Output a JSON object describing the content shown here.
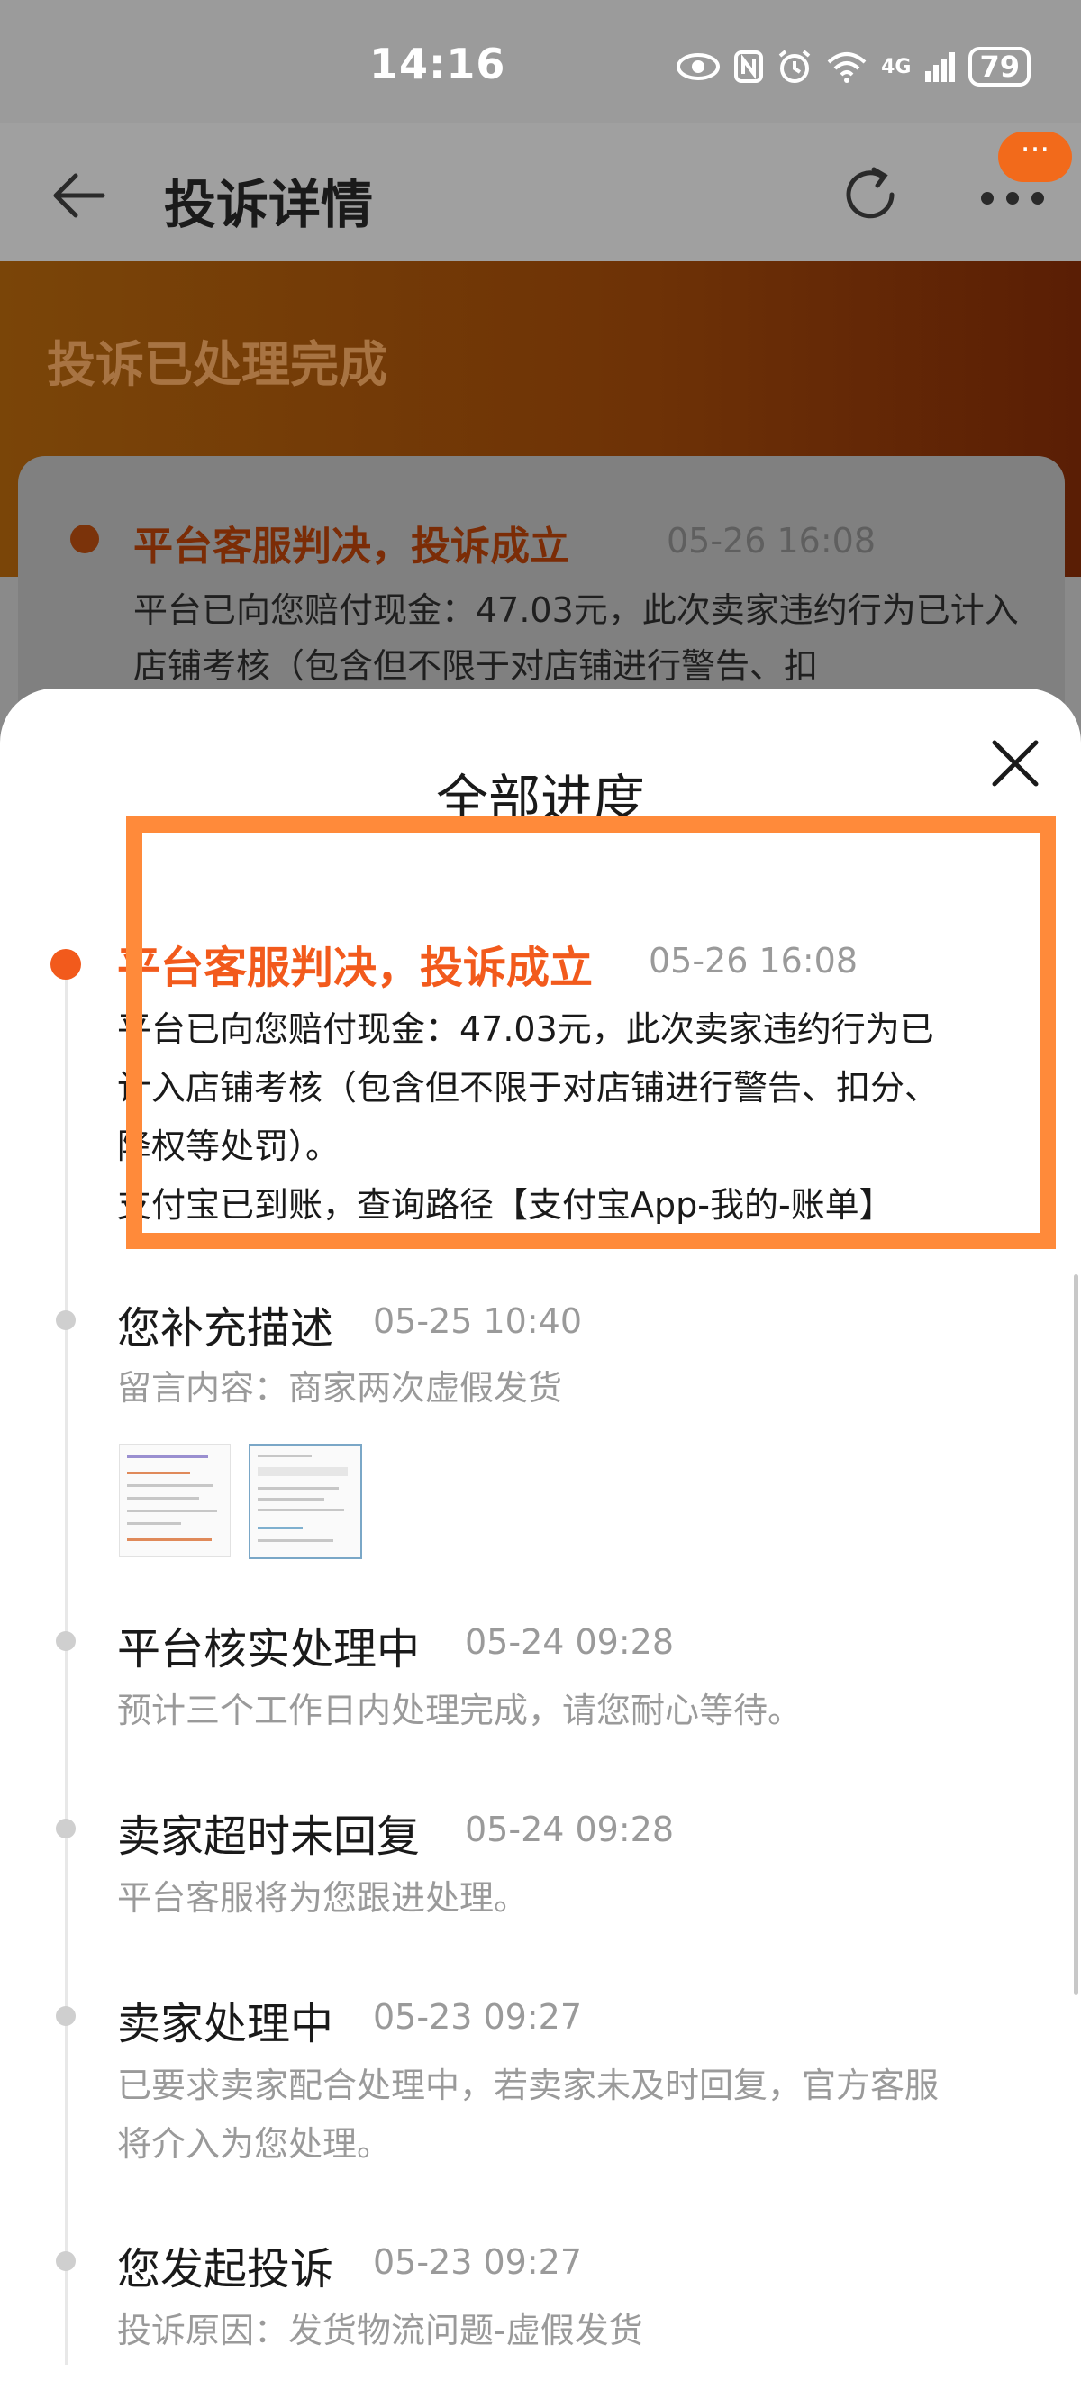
{
  "status_bar": {
    "time": "14:16",
    "indicators": [
      "eye-icon",
      "nfc-icon",
      "alarm-icon",
      "wifi-icon",
      "4G",
      "signal-icon"
    ],
    "net": "4G",
    "battery": "79"
  },
  "header": {
    "title": "投诉详情",
    "badge": "···"
  },
  "banner": {
    "status": "投诉已处理完成",
    "card_title": "平台客服判决，投诉成立",
    "card_time": "05-26 16:08",
    "card_text": "平台已向您赔付现金：47.03元，此次卖家违约行为已计入店铺考核（包含但不限于对店铺进行警告、扣"
  },
  "sheet": {
    "title": "全部进度",
    "items": [
      {
        "title": "平台客服判决，投诉成立",
        "time": "05-26 16:08",
        "desc_lines": [
          "平台已向您赔付现金：47.03元，此次卖家违约行为已",
          "计入店铺考核（包含但不限于对店铺进行警告、扣分、",
          "降权等处罚）。",
          "支付宝已到账，查询路径【支付宝App-我的-账单】"
        ]
      },
      {
        "title": "您补充描述",
        "time": "05-25 10:40",
        "desc": "留言内容：商家两次虚假发货"
      },
      {
        "title": "平台核实处理中",
        "time": "05-24 09:28",
        "desc": "预计三个工作日内处理完成，请您耐心等待。"
      },
      {
        "title": "卖家超时未回复",
        "time": "05-24 09:28",
        "desc": "平台客服将为您跟进处理。"
      },
      {
        "title": "卖家处理中",
        "time": "05-23 09:27",
        "desc_lines": [
          "已要求卖家配合处理中，若卖家未及时回复，官方客服",
          "将介入为您处理。"
        ]
      },
      {
        "title": "您发起投诉",
        "time": "05-23 09:27",
        "desc": "投诉原因：发货物流问题-虚假发货"
      }
    ]
  },
  "colors": {
    "accent": "#f25a1c",
    "highlight": "#ff8a3a",
    "muted_text": "#9a9a9a"
  }
}
